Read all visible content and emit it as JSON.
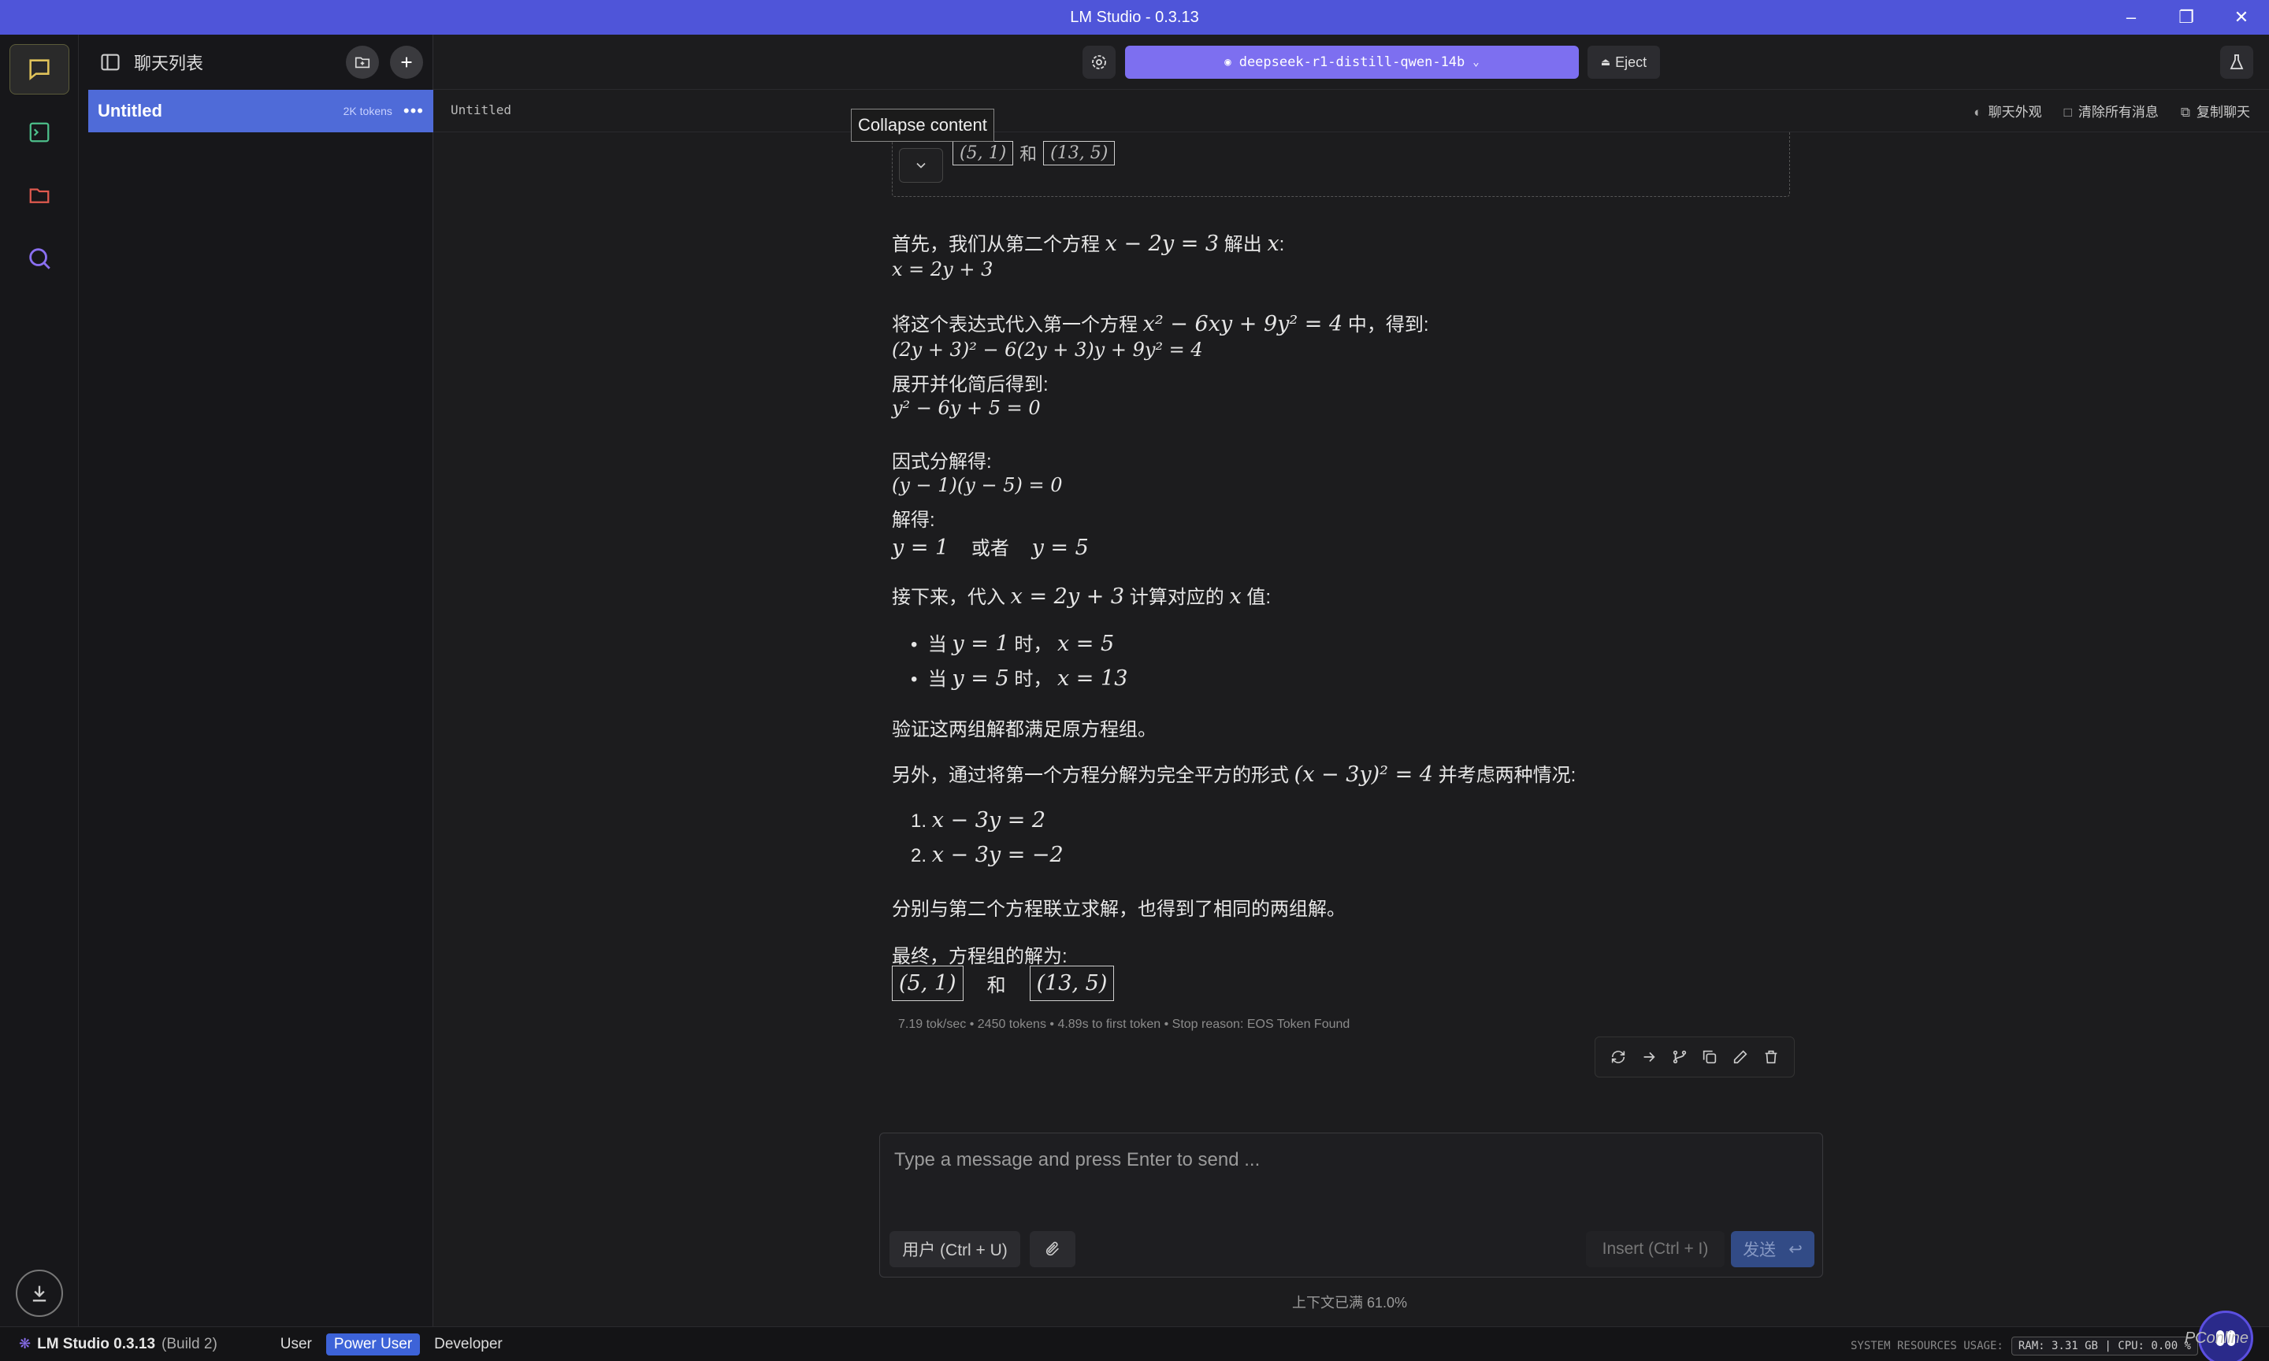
{
  "window": {
    "title": "LM Studio - 0.3.13"
  },
  "sidebar": {
    "title": "聊天列表",
    "chats": [
      {
        "name": "Untitled",
        "tokens": "2K tokens"
      }
    ]
  },
  "topbar": {
    "model": "deepseek-r1-distill-qwen-14b",
    "eject": "Eject"
  },
  "subbar": {
    "crumb": "Untitled",
    "appearance": "聊天外观",
    "clear_all": "清除所有消息",
    "copy_chat": "复制聊天"
  },
  "tooltip": "Collapse content",
  "think_answer": {
    "a": "(5, 1)",
    "and": "和",
    "b": "(13, 5)"
  },
  "message": {
    "l1_text": "首先，我们从第二个方程",
    "l1_eq": "x − 2y = 3",
    "l1_text2": "解出",
    "l1_var": "x",
    "l1_colon": ":",
    "l2": "x = 2y + 3",
    "l3_text": "将这个表达式代入第一个方程",
    "l3_eq": "x² − 6xy + 9y² = 4",
    "l3_text2": "中，得到:",
    "l4": "(2y + 3)² − 6(2y + 3)y + 9y² = 4",
    "l5": "展开并化简后得到:",
    "l6": "y² − 6y + 5 = 0",
    "l7": "因式分解得:",
    "l8": "(y − 1)(y − 5) = 0",
    "l9": "解得:",
    "l10a": "y = 1",
    "l10b": "或者",
    "l10c": "y = 5",
    "l11_text": "接下来，代入",
    "l11_eq": "x = 2y + 3",
    "l11_text2": "计算对应的",
    "l11_var": "x",
    "l11_text3": "值:",
    "b1_pre": "当",
    "b1_eq": "y = 1",
    "b1_mid": "时，",
    "b1_res": "x = 5",
    "b2_pre": "当",
    "b2_eq": "y = 5",
    "b2_mid": "时，",
    "b2_res": "x = 13",
    "l12": "验证这两组解都满足原方程组。",
    "l13_text": "另外，通过将第一个方程分解为完全平方的形式",
    "l13_eq": "(x − 3y)² = 4",
    "l13_text2": "并考虑两种情况:",
    "o1_num": "1.",
    "o1": "x − 3y = 2",
    "o2_num": "2.",
    "o2": "x − 3y = −2",
    "l14": "分别与第二个方程联立求解，也得到了相同的两组解。",
    "l15": "最终，方程组的解为:",
    "final_a": "(5, 1)",
    "final_and": "和",
    "final_b": "(13, 5)",
    "stats": "7.19 tok/sec • 2450 tokens • 4.89s to first token • Stop reason: EOS Token Found"
  },
  "composer": {
    "placeholder": "Type a message and press Enter to send ...",
    "role": "用户 (Ctrl + U)",
    "insert": "Insert (Ctrl + I)",
    "send": "发送",
    "send_icon": "↩"
  },
  "context_full": "上下文已满 61.0%",
  "statusbar": {
    "brand": "LM Studio 0.3.13",
    "build": "(Build 2)",
    "modes": [
      "User",
      "Power User",
      "Developer"
    ],
    "sysres_label": "SYSTEM RESOURCES USAGE:",
    "sysres_vals": "RAM: 3.31 GB  |  CPU: 0.00 %"
  },
  "watermark": "PConline",
  "accent": "#4f55d9"
}
